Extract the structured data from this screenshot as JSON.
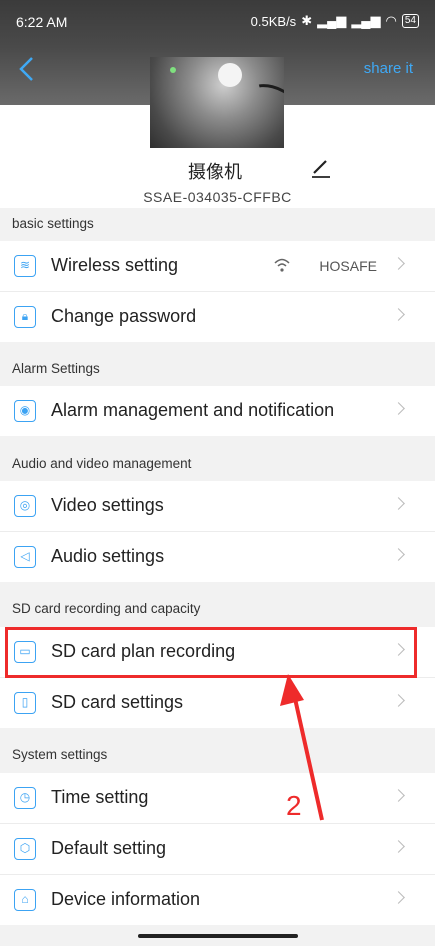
{
  "status": {
    "time": "6:22 AM",
    "speed": "0.5KB/s",
    "battery": "54"
  },
  "header": {
    "share_label": "share it"
  },
  "device": {
    "name": "摄像机",
    "serial": "SSAE-034035-CFFBC"
  },
  "sections": [
    {
      "title": "basic settings"
    },
    {
      "title": "Alarm Settings"
    },
    {
      "title": "Audio and video management"
    },
    {
      "title": "SD card recording and capacity"
    },
    {
      "title": "System settings"
    }
  ],
  "items": {
    "wireless": {
      "label": "Wireless setting",
      "value": "HOSAFE",
      "icon": "wifi-icon"
    },
    "password": {
      "label": "Change password",
      "icon": "lock-icon"
    },
    "alarm": {
      "label": "Alarm management and notification",
      "icon": "alarm-icon"
    },
    "video": {
      "label": "Video settings",
      "icon": "camera-icon"
    },
    "audio": {
      "label": "Audio settings",
      "icon": "speaker-icon"
    },
    "sd_plan": {
      "label": "SD card plan recording",
      "icon": "video-record-icon"
    },
    "sd_settings": {
      "label": "SD card settings",
      "icon": "sd-card-icon"
    },
    "time": {
      "label": "Time setting",
      "icon": "clock-icon"
    },
    "default": {
      "label": "Default setting",
      "icon": "reset-icon"
    },
    "device_info": {
      "label": "Device information",
      "icon": "device-info-icon"
    }
  },
  "annotation": {
    "number": "2",
    "color": "#ee2b2b"
  },
  "colors": {
    "accent": "#3ca3f3",
    "highlight": "#ee2b2b"
  }
}
